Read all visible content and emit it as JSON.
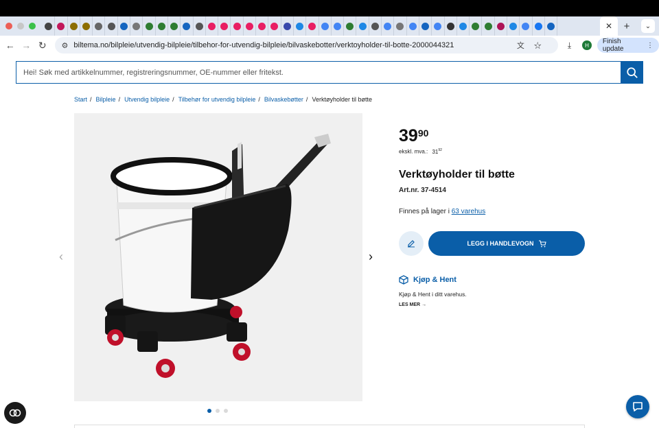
{
  "browser": {
    "url": "biltema.no/bilpleie/utvendig-bilpleie/tilbehor-for-utvendig-bilpleie/bilvaskebotter/verktoyholder-til-botte-2000044321",
    "finish_update_label": "Finish update",
    "avatar_letter": "H",
    "favicon_colors": [
      "#444",
      "#c2185b",
      "#8d6e00",
      "#8d6e00",
      "#666",
      "#555",
      "#1565c0",
      "#777",
      "#2e7d32",
      "#2e7d32",
      "#2e7d32",
      "#1565c0",
      "#555",
      "#e91e63",
      "#e91e63",
      "#e91e63",
      "#e91e63",
      "#e91e63",
      "#e91e63",
      "#3949ab",
      "#1e88e5",
      "#e91e63",
      "#4285f4",
      "#4285f4",
      "#2e7d32",
      "#1e88e5",
      "#555",
      "#4285f4",
      "#777",
      "#4285f4",
      "#1565c0",
      "#4285f4",
      "#333",
      "#1e88e5",
      "#2e7d32",
      "#2e7d32",
      "#ad1457",
      "#1e88e5",
      "#4285f4",
      "#1877f2",
      "#1565c0"
    ]
  },
  "search": {
    "placeholder": "Hei! Søk med artikkelnummer, registreringsnummer, OE-nummer eller fritekst."
  },
  "breadcrumb": {
    "items": [
      "Start",
      "Bilpleie",
      "Utvendig bilpleie",
      "Tilbehør for utvendig bilpleie",
      "Bilvaskebøtter"
    ],
    "current": "Verktøyholder til bøtte"
  },
  "product": {
    "price_main": "39",
    "price_cents": "90",
    "ex_vat_label": "ekskl. mva.:",
    "ex_vat_main": "31",
    "ex_vat_cents": "92",
    "title": "Verktøyholder til bøtte",
    "art_nr": "Art.nr. 37-4514",
    "stock_prefix": "Finnes på lager i",
    "stock_link": "63 varehus",
    "add_to_cart": "LEGG I HANDLEVOGN",
    "kh_title": "Kjøp & Hent",
    "kh_text": "Kjøp & Hent i ditt varehus.",
    "read_more": "LES MER"
  },
  "gallery": {
    "active_index": 0,
    "count": 3
  },
  "colors": {
    "brand_blue": "#0a5ea8"
  }
}
